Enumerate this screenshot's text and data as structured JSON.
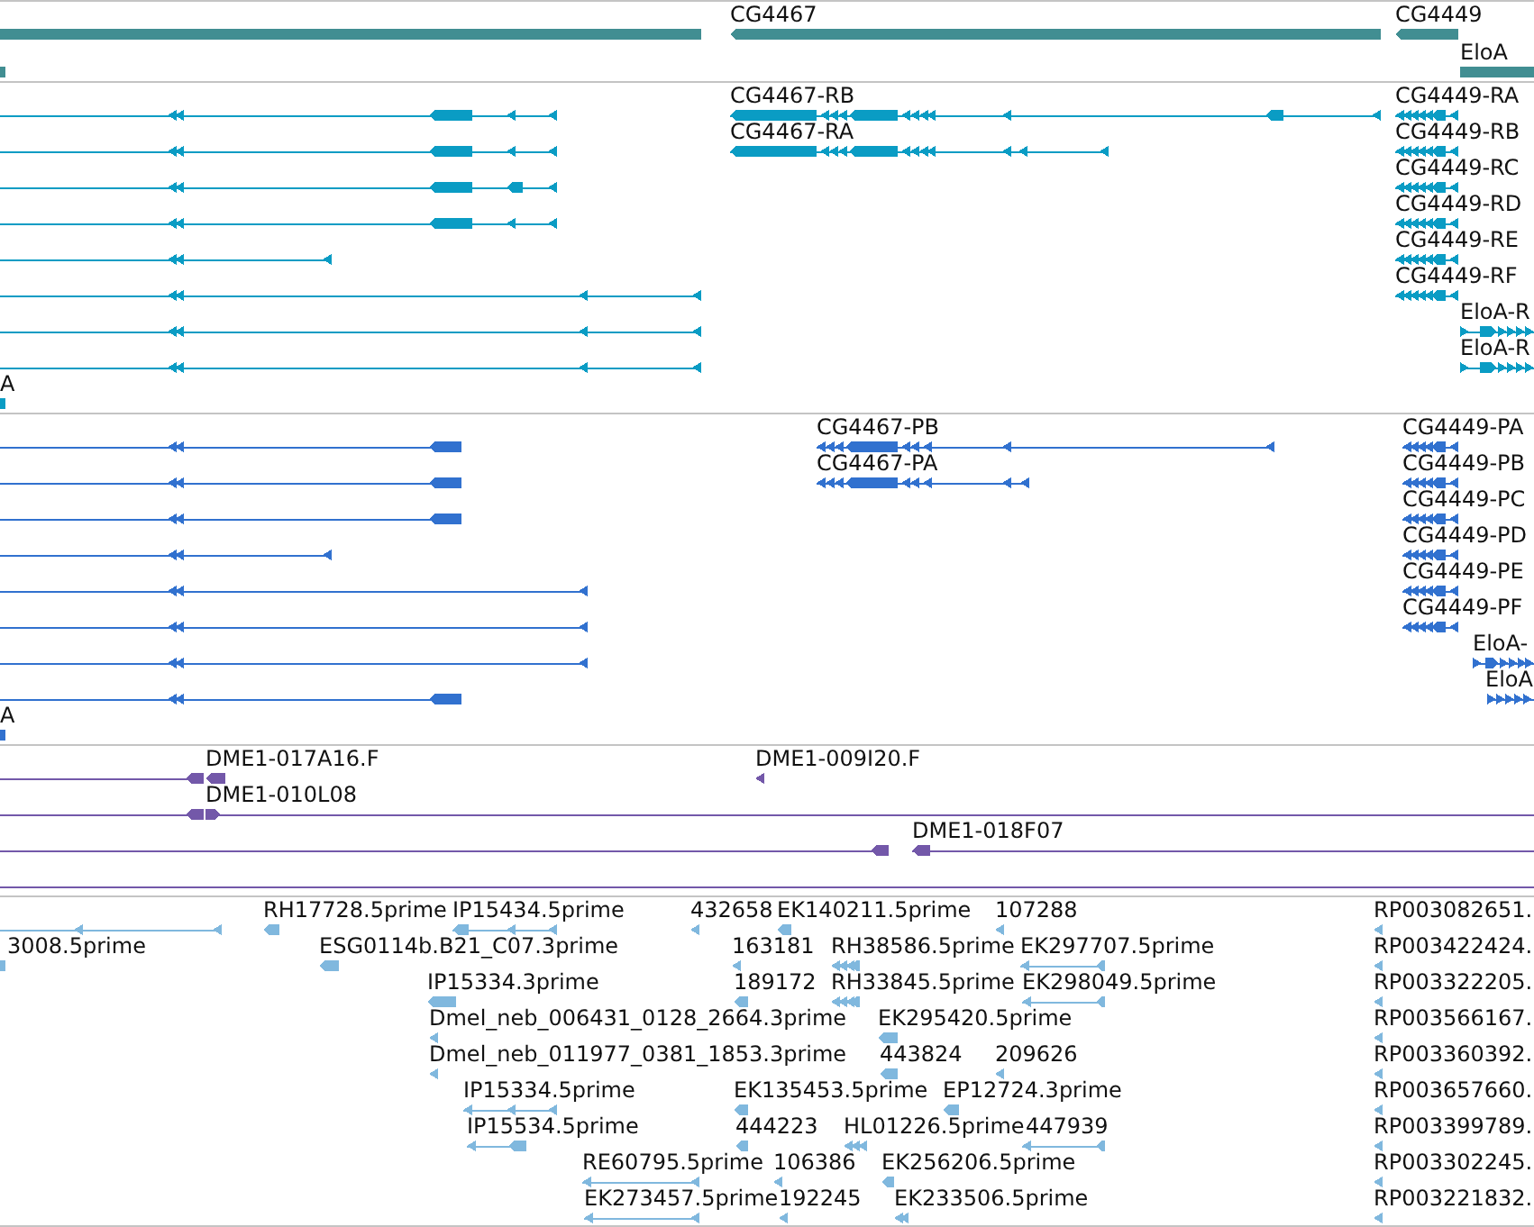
{
  "tracks": [
    {
      "kind": "gene",
      "features": [
        {
          "reverse": true
        },
        {
          "label": "CG4467",
          "reverse": true
        },
        {
          "label": "CG4449",
          "reverse": true
        },
        {
          "reverse": true
        },
        {
          "label": "EloA",
          "reverse": false
        }
      ]
    },
    {
      "kind": "transcript",
      "features": [
        {
          "reverse": true
        },
        {
          "label": "CG4467-RB",
          "reverse": true
        },
        {
          "label": "CG4449-RA",
          "reverse": true
        },
        {
          "reverse": true
        },
        {
          "label": "CG4467-RA",
          "reverse": true
        },
        {
          "label": "CG4449-RB",
          "reverse": true
        },
        {
          "reverse": true
        },
        {
          "label": "CG4449-RC",
          "reverse": true
        },
        {
          "reverse": true
        },
        {
          "label": "CG4449-RD",
          "reverse": true
        },
        {
          "reverse": true
        },
        {
          "label": "CG4449-RE",
          "reverse": true
        },
        {
          "reverse": true
        },
        {
          "label": "CG4449-RF",
          "reverse": true
        },
        {
          "reverse": true
        },
        {
          "label": "EloA-R",
          "reverse": false
        },
        {
          "reverse": true
        },
        {
          "label": "EloA-R",
          "reverse": false
        },
        {
          "label": "A",
          "reverse": true
        }
      ]
    },
    {
      "kind": "protein",
      "features": [
        {
          "reverse": true
        },
        {
          "label": "CG4467-PB",
          "reverse": true
        },
        {
          "label": "CG4449-PA",
          "reverse": true
        },
        {
          "reverse": true
        },
        {
          "label": "CG4467-PA",
          "reverse": true
        },
        {
          "label": "CG4449-PB",
          "reverse": true
        },
        {
          "reverse": true
        },
        {
          "label": "CG4449-PC",
          "reverse": true
        },
        {
          "reverse": true
        },
        {
          "label": "CG4449-PD",
          "reverse": true
        },
        {
          "reverse": true
        },
        {
          "label": "CG4449-PE",
          "reverse": true
        },
        {
          "reverse": true
        },
        {
          "label": "CG4449-PF",
          "reverse": true
        },
        {
          "reverse": true
        },
        {
          "label": "EloA-",
          "reverse": false
        },
        {
          "reverse": true
        },
        {
          "label": "EloA",
          "reverse": false
        },
        {
          "label": "A",
          "reverse": true
        }
      ]
    },
    {
      "kind": "clone",
      "features": [
        {
          "kind": "read",
          "reverse": true
        },
        {
          "kind": "read",
          "label": "DME1-017A16.F",
          "reverse": true
        },
        {
          "kind": "read",
          "label": "DME1-009I20.F",
          "reverse": true
        },
        {
          "kind": "read",
          "reverse": true
        },
        {
          "kind": "read",
          "label": "DME1-010L08",
          "reverse": false
        },
        {
          "kind": "read",
          "reverse": true
        },
        {
          "kind": "read",
          "label": "DME1-018F07",
          "reverse": true
        },
        {
          "kind": "span"
        }
      ]
    },
    {
      "kind": "est",
      "features": [
        {
          "reverse": true
        },
        {
          "label": "RH17728.5prime",
          "reverse": true
        },
        {
          "label": "IP15434.5prime",
          "reverse": true
        },
        {
          "label": "432658",
          "reverse": true
        },
        {
          "label": "EK140211.5prime",
          "reverse": true
        },
        {
          "label": "107288",
          "reverse": true
        },
        {
          "label": "RP003082651.",
          "reverse": true
        },
        {
          "label": "3008.5prime",
          "reverse": true
        },
        {
          "label": "ESG0114b.B21_C07.3prime",
          "reverse": true
        },
        {
          "label": "163181",
          "reverse": true
        },
        {
          "label": "RH38586.5prime",
          "reverse": true
        },
        {
          "label": "EK297707.5prime",
          "reverse": true
        },
        {
          "label": "RP003422424.",
          "reverse": true
        },
        {
          "label": "IP15334.3prime",
          "reverse": true
        },
        {
          "label": "189172",
          "reverse": true
        },
        {
          "label": "RH33845.5prime",
          "reverse": true
        },
        {
          "label": "EK298049.5prime",
          "reverse": true
        },
        {
          "label": "RP003322205.",
          "reverse": true
        },
        {
          "label": "Dmel_neb_006431_0128_2664.3prime",
          "reverse": true
        },
        {
          "label": "EK295420.5prime",
          "reverse": true
        },
        {
          "label": "RP003566167.",
          "reverse": true
        },
        {
          "label": "Dmel_neb_011977_0381_1853.3prime",
          "reverse": true
        },
        {
          "label": "443824",
          "reverse": true
        },
        {
          "label": "209626",
          "reverse": true
        },
        {
          "label": "RP003360392.",
          "reverse": true
        },
        {
          "label": "IP15334.5prime",
          "reverse": true
        },
        {
          "label": "EK135453.5prime",
          "reverse": true
        },
        {
          "label": "EP12724.3prime",
          "reverse": true
        },
        {
          "label": "RP003657660.",
          "reverse": true
        },
        {
          "label": "IP15534.5prime",
          "reverse": true
        },
        {
          "label": "444223",
          "reverse": true
        },
        {
          "label": "HL01226.5prime",
          "reverse": true
        },
        {
          "label": "447939",
          "reverse": true
        },
        {
          "label": "RP003399789.",
          "reverse": true
        },
        {
          "label": "RE60795.5prime",
          "reverse": true
        },
        {
          "label": "106386",
          "reverse": true
        },
        {
          "label": "EK256206.5prime",
          "reverse": true
        },
        {
          "label": "RP003302245.",
          "reverse": true
        },
        {
          "label": "EK273457.5prime",
          "reverse": true
        },
        {
          "label": "192245",
          "reverse": true
        },
        {
          "label": "EK233506.5prime",
          "reverse": true
        },
        {
          "label": "RP003221832.",
          "reverse": true
        }
      ]
    }
  ]
}
